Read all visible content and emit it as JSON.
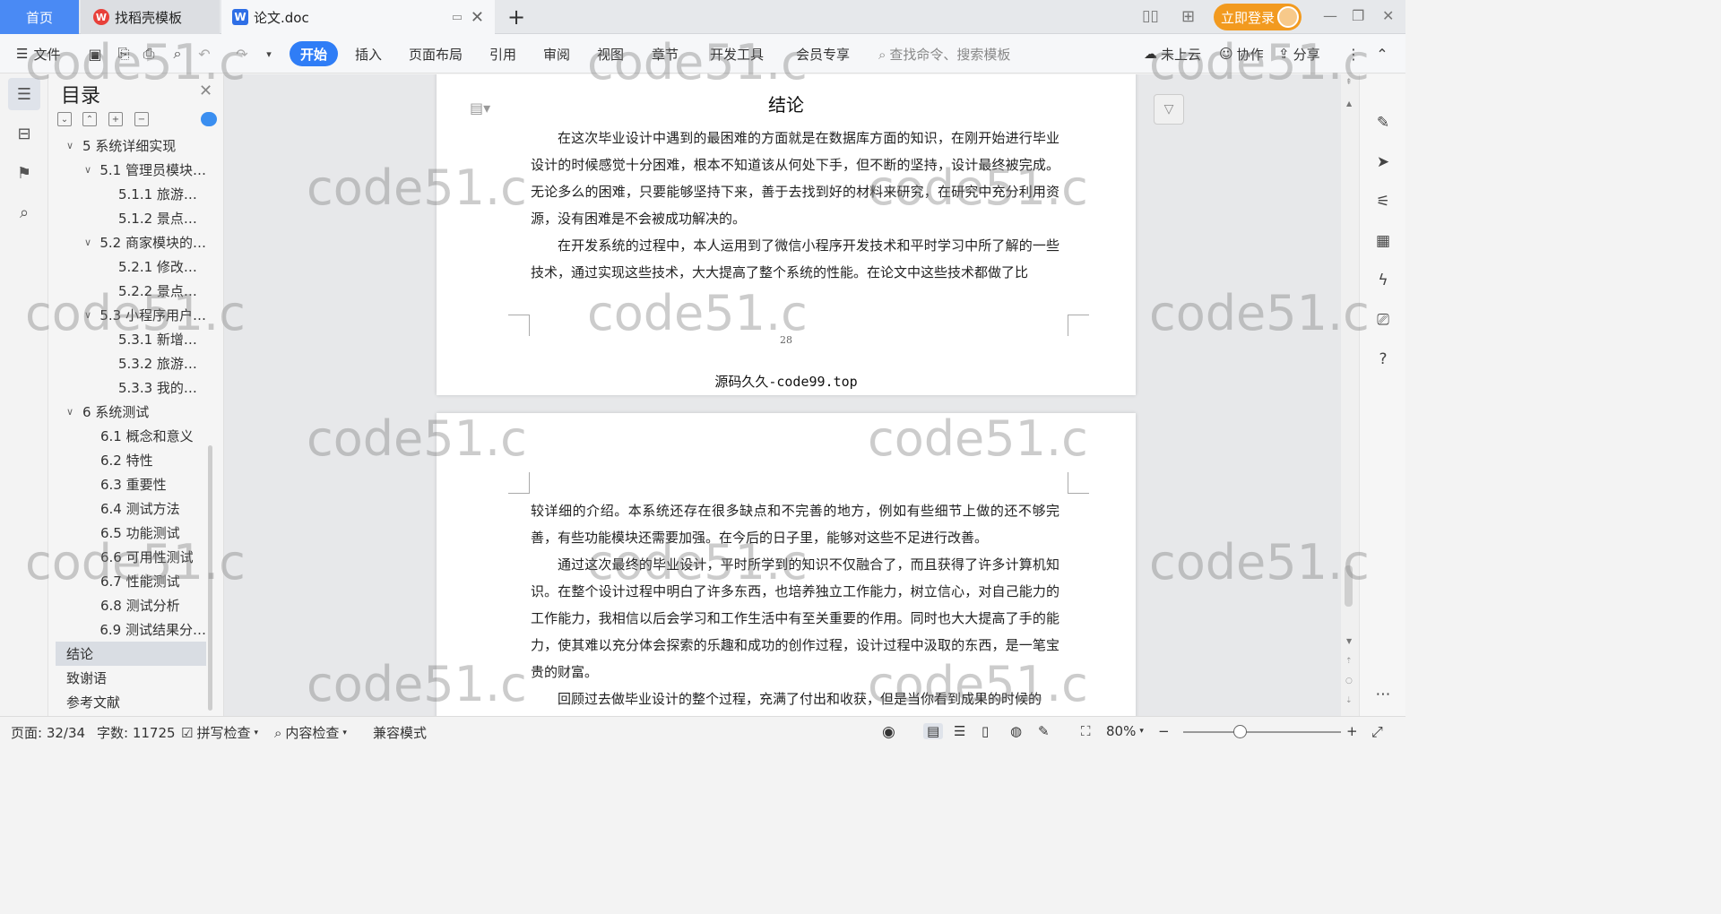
{
  "tabs": {
    "home": "首页",
    "template": "找稻壳模板",
    "doc": "论文.doc",
    "add": "+"
  },
  "account": {
    "login": "立即登录"
  },
  "ribbon": {
    "file": "文件",
    "tabs": [
      "开始",
      "插入",
      "页面布局",
      "引用",
      "审阅",
      "视图",
      "章节",
      "开发工具",
      "会员专享"
    ],
    "search_placeholder": "查找命令、搜索模板",
    "cloud": "未上云",
    "collab": "协作",
    "share": "分享"
  },
  "toc": {
    "title": "目录",
    "items": [
      {
        "label": "5 系统详细实现",
        "level": 0
      },
      {
        "label": "5.1  管理员模块…",
        "level": 1
      },
      {
        "label": "5.1.1  旅游…",
        "level": 2
      },
      {
        "label": "5.1.2  景点…",
        "level": 2
      },
      {
        "label": "5.2  商家模块的…",
        "level": 1
      },
      {
        "label": "5.2.1  修改…",
        "level": 2
      },
      {
        "label": "5.2.2  景点…",
        "level": 2
      },
      {
        "label": "5.3  小程序用户…",
        "level": 1
      },
      {
        "label": "5.3.1  新增…",
        "level": 2
      },
      {
        "label": "5.3.2  旅游…",
        "level": 2
      },
      {
        "label": "5.3.3  我的…",
        "level": 2
      },
      {
        "label": "6 系统测试",
        "level": 0
      },
      {
        "label": "6.1 概念和意义",
        "level": 1
      },
      {
        "label": "6.2 特性",
        "level": 1
      },
      {
        "label": "6.3 重要性",
        "level": 1
      },
      {
        "label": "6.4 测试方法",
        "level": 1
      },
      {
        "label": "6.5  功能测试",
        "level": 1
      },
      {
        "label": "6.6 可用性测试",
        "level": 1
      },
      {
        "label": "6.7 性能测试",
        "level": 1
      },
      {
        "label": "6.8 测试分析",
        "level": 1
      },
      {
        "label": "6.9 测试结果分…",
        "level": 1
      },
      {
        "label": "结论",
        "level": 0
      },
      {
        "label": "致谢语",
        "level": 0
      },
      {
        "label": "参考文献",
        "level": 0
      }
    ]
  },
  "document": {
    "heading": "结论",
    "page1_paragraphs": [
      "在这次毕业设计中遇到的最困难的方面就是在数据库方面的知识，在刚开始进行毕业设计的时候感觉十分困难，根本不知道该从何处下手，但不断的坚持，设计最终被完成。无论多么的困难，只要能够坚持下来，善于去找到好的材料来研究，在研究中充分利用资源，没有困难是不会被成功解决的。",
      "在开发系统的过程中，本人运用到了微信小程序开发技术和平时学习中所了解的一些技术，通过实现这些技术，大大提高了整个系统的性能。在论文中这些技术都做了比"
    ],
    "page_number": "28",
    "footer": "源码久久-code99.top",
    "page2_paragraphs": [
      "较详细的介绍。本系统还存在很多缺点和不完善的地方，例如有些细节上做的还不够完善，有些功能模块还需要加强。在今后的日子里，能够对这些不足进行改善。",
      "通过这次最终的毕业设计，平时所学到的知识不仅融合了，而且获得了许多计算机知识。在整个设计过程中明白了许多东西，也培养独立工作能力，树立信心，对自己能力的工作能力，我相信以后会学习和工作生活中有至关重要的作用。同时也大大提高了手的能力，使其难以充分体会探索的乐趣和成功的创作过程，设计过程中汲取的东西，是一笔宝贵的财富。",
      "回顾过去做毕业设计的整个过程，充满了付出和收获，但是当你看到成果的时候的"
    ]
  },
  "status": {
    "page": "页面: 32/34",
    "words": "字数: 11725",
    "spell": "拼写检查",
    "content_check": "内容检查",
    "compat": "兼容模式",
    "zoom": "80%"
  },
  "watermark": "code51.c",
  "colors": {
    "accent": "#2f7df6",
    "login": "#f29a1f",
    "home_tab": "#4a8af4"
  }
}
